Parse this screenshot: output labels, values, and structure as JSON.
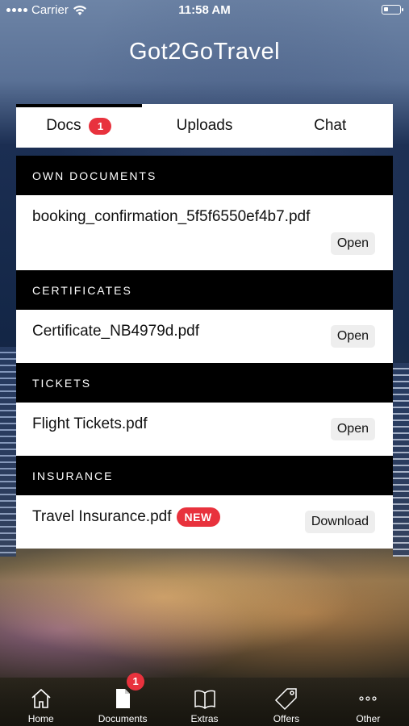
{
  "status_bar": {
    "carrier": "Carrier",
    "time": "11:58 AM"
  },
  "app_title": "Got2GoTravel",
  "tabs": [
    {
      "label": "Docs",
      "badge": "1",
      "active": true
    },
    {
      "label": "Uploads"
    },
    {
      "label": "Chat"
    }
  ],
  "sections": {
    "own_documents": {
      "header": "OWN DOCUMENTS",
      "file": "booking_confirmation_5f5f6550ef4b7.pdf",
      "action": "Open"
    },
    "certificates": {
      "header": "CERTIFICATES",
      "file": "Certificate_NB4979d.pdf",
      "action": "Open"
    },
    "tickets": {
      "header": "TICKETS",
      "file": "Flight Tickets.pdf",
      "action": "Open"
    },
    "insurance": {
      "header": "INSURANCE",
      "file": "Travel Insurance.pdf",
      "badge": "NEW",
      "action": "Download"
    }
  },
  "tabbar": {
    "items": [
      {
        "label": "Home",
        "icon": "home-icon"
      },
      {
        "label": "Documents",
        "icon": "document-icon",
        "badge": "1"
      },
      {
        "label": "Extras",
        "icon": "book-icon"
      },
      {
        "label": "Offers",
        "icon": "tag-icon"
      },
      {
        "label": "Other",
        "icon": "more-icon"
      }
    ]
  },
  "colors": {
    "accent": "#e8323d",
    "header_bg": "#000000"
  }
}
